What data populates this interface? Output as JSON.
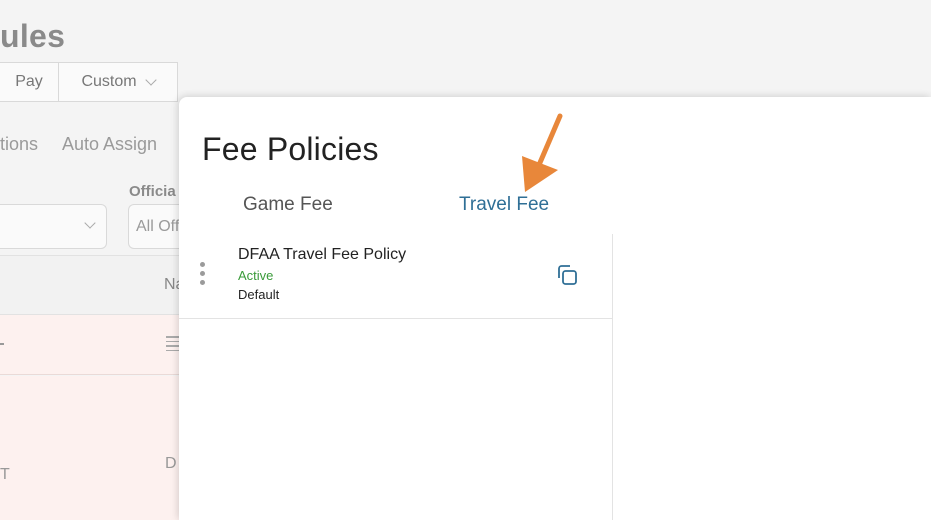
{
  "background": {
    "title_fragment": "ules",
    "seg_pay": "Pay",
    "seg_custom": "Custom",
    "tab_options_fragment": "tions",
    "tab_auto_assign": "Auto Assign",
    "officials_label_fragment": "Officia",
    "officials_select_fragment": "All Off",
    "column_fragment": "Na",
    "row2_left_fragment": "T",
    "row2_right_fragment": "D"
  },
  "panel": {
    "title": "Fee Policies",
    "tabs": [
      {
        "label": "Game Fee",
        "active": false
      },
      {
        "label": "Travel Fee",
        "active": true
      }
    ],
    "policies": [
      {
        "name": "DFAA Travel Fee Policy",
        "status": "Active",
        "tag": "Default"
      }
    ]
  },
  "colors": {
    "active_tab": "#2f6f96",
    "status_active": "#3a9b3a",
    "copy_icon": "#2f6f96",
    "arrow": "#e8873a",
    "row_highlight": "#fdf1ef"
  },
  "icons": {
    "more": "kebab-vertical-icon",
    "copy": "copy-icon",
    "pointer": "arrow-annotation-icon"
  }
}
